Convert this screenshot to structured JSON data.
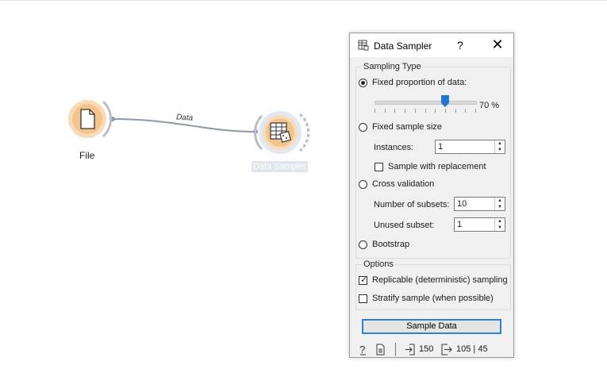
{
  "canvas": {
    "nodes": [
      {
        "id": "file",
        "label": "File"
      },
      {
        "id": "data-sampler",
        "label": "Data Sampler"
      }
    ],
    "link_label": "Data",
    "colors": {
      "node_fill": "#f5c48a",
      "node_ring": "#f8dcb9",
      "link": "#8e9aa6",
      "accent": "#1e78d3"
    }
  },
  "dialog": {
    "title": "Data Sampler",
    "help_glyph": "?",
    "close_glyph": "✕",
    "sampling_type": {
      "title": "Sampling Type",
      "fixed_proportion": {
        "label": "Fixed proportion of data:",
        "selected": true,
        "value_percent": 70,
        "display": "70 %"
      },
      "fixed_size": {
        "label": "Fixed sample size",
        "selected": false,
        "instances_label": "Instances:",
        "instances_value": "1",
        "with_replacement_label": "Sample with replacement",
        "with_replacement_checked": false
      },
      "cross_validation": {
        "label": "Cross validation",
        "selected": false,
        "subsets_label": "Number of subsets:",
        "subsets_value": "10",
        "unused_label": "Unused subset:",
        "unused_value": "1"
      },
      "bootstrap": {
        "label": "Bootstrap",
        "selected": false
      }
    },
    "options": {
      "title": "Options",
      "replicable": {
        "label": "Replicable (deterministic) sampling",
        "checked": true
      },
      "stratify": {
        "label": "Stratify sample (when possible)",
        "checked": false
      }
    },
    "sample_button": "Sample Data",
    "status": {
      "input_count": "150",
      "output_counts": "105 | 45"
    }
  }
}
